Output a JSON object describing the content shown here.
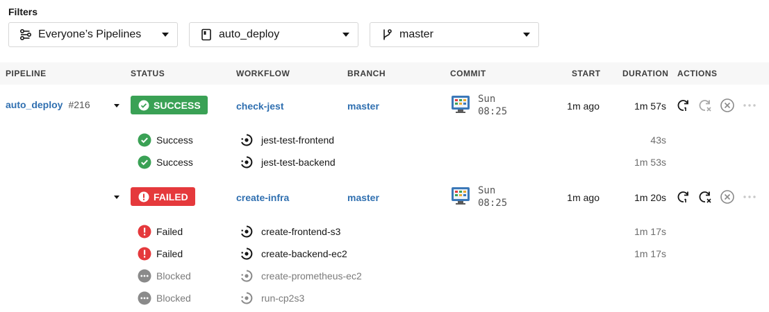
{
  "filters": {
    "label": "Filters",
    "pipelines": {
      "icon": "pipelines-filter-icon",
      "value": "Everyone’s Pipelines"
    },
    "project": {
      "icon": "project-icon",
      "value": "auto_deploy"
    },
    "branch": {
      "icon": "branch-icon",
      "value": "master"
    }
  },
  "table": {
    "headers": {
      "pipeline": "PIPELINE",
      "status": "STATUS",
      "workflow": "WORKFLOW",
      "branch": "BRANCH",
      "commit": "COMMIT",
      "start": "START",
      "duration": "DURATION",
      "actions": "ACTIONS"
    },
    "pipeline": {
      "name": "auto_deploy",
      "number": "#216"
    },
    "workflows": [
      {
        "status": "SUCCESS",
        "status_color": "#3aa155",
        "name": "check-jest",
        "branch": "master",
        "commit_day": "Sun",
        "commit_time": "08:25",
        "start": "1m ago",
        "duration": "1m 57s",
        "jobs": [
          {
            "status": "Success",
            "name": "jest-test-frontend",
            "duration": "43s"
          },
          {
            "status": "Success",
            "name": "jest-test-backend",
            "duration": "1m 53s"
          }
        ]
      },
      {
        "status": "FAILED",
        "status_color": "#e5393c",
        "name": "create-infra",
        "branch": "master",
        "commit_day": "Sun",
        "commit_time": "08:25",
        "start": "1m ago",
        "duration": "1m 20s",
        "jobs": [
          {
            "status": "Failed",
            "name": "create-frontend-s3",
            "duration": "1m 17s"
          },
          {
            "status": "Failed",
            "name": "create-backend-ec2",
            "duration": "1m 17s"
          },
          {
            "status": "Blocked",
            "name": "create-prometheus-ec2",
            "duration": ""
          },
          {
            "status": "Blocked",
            "name": "run-cp2s3",
            "duration": ""
          }
        ]
      }
    ]
  }
}
